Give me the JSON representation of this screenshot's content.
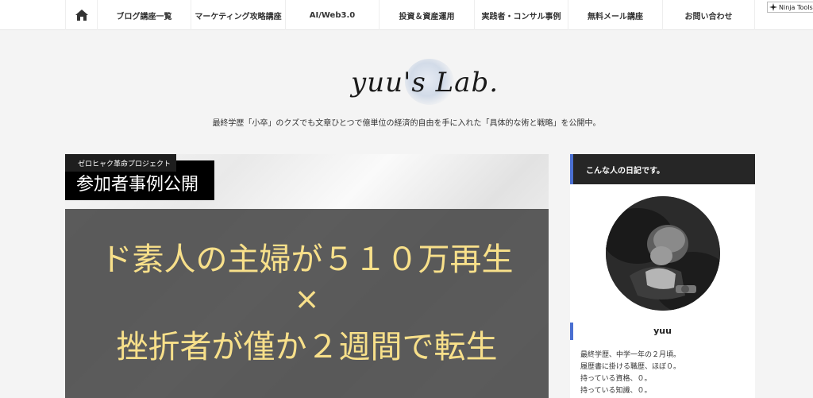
{
  "nav": {
    "home_icon": "home-icon",
    "items": [
      {
        "label": "ブログ講座一覧"
      },
      {
        "label": "マーケティング攻略講座"
      },
      {
        "label": "AI/Web3.0"
      },
      {
        "label": "投資＆資産運用"
      },
      {
        "label": "実践者・コンサル事例"
      },
      {
        "label": "無料メール講座"
      },
      {
        "label": "お問い合わせ"
      }
    ]
  },
  "ninja": {
    "label": "Ninja Tools",
    "icon": "ninja-icon"
  },
  "site": {
    "logo": "yuu's Lab.",
    "tagline": "最終学歴「小卒」のクズでも文章ひとつで億単位の経済的自由を手に入れた「具体的な術と戦略」を公開中。"
  },
  "hero": {
    "badge": "ゼロヒャク革命プロジェクト",
    "subtitle": "参加者事例公開",
    "line1": "ド素人の主婦が５１０万再生",
    "cross": "×",
    "line2": "挫折者が僅か２週間で転生",
    "text_color": "#f8e08a"
  },
  "sidebar": {
    "heading": "こんな人の日記です。",
    "name": "yuu",
    "bio": [
      "最終学歴、中学一年の２月頃。",
      "履歴書に掛ける職歴、ほぼ０。",
      "持っている資格、０。",
      "持っている知識、０。"
    ],
    "accent": "#4a6fd1"
  }
}
